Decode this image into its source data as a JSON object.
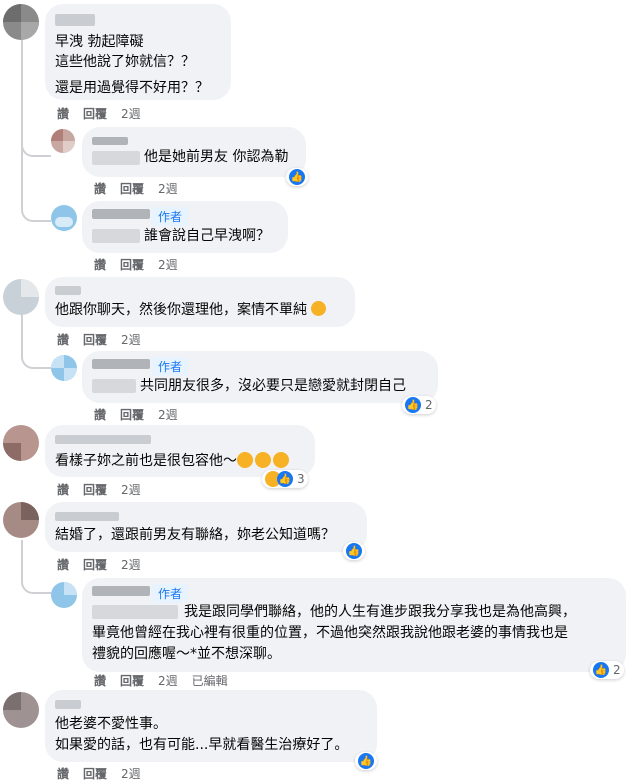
{
  "comments": [
    {
      "id": "c1",
      "lines": [
        "早洩 勃起障礙",
        "這些他說了妳就信？？",
        "還是用過覺得不好用？？"
      ],
      "actions": {
        "like": "讚",
        "reply": "回覆",
        "time": "2週"
      }
    },
    {
      "id": "c2",
      "lines": [
        "他是她前男友 你認為勒"
      ],
      "actions": {
        "like": "讚",
        "reply": "回覆",
        "time": "2週"
      }
    },
    {
      "id": "c3",
      "author_badge": "作者",
      "lines": [
        "誰會說自己早洩啊？"
      ],
      "actions": {
        "like": "讚",
        "reply": "回覆",
        "time": "2週"
      }
    },
    {
      "id": "c4",
      "lines": [
        "他跟你聊天，然後你還理他，案情不單純"
      ],
      "actions": {
        "like": "讚",
        "reply": "回覆",
        "time": "2週"
      }
    },
    {
      "id": "c5",
      "author_badge": "作者",
      "lines": [
        "共同朋友很多，沒必要只是戀愛就封閉自己"
      ],
      "reaction_count": "2",
      "actions": {
        "like": "讚",
        "reply": "回覆",
        "time": "2週"
      }
    },
    {
      "id": "c6",
      "lines": [
        "看樣子妳之前也是很包容他～"
      ],
      "reaction_count": "3",
      "actions": {
        "like": "讚",
        "reply": "回覆",
        "time": "2週"
      }
    },
    {
      "id": "c7",
      "lines": [
        "結婚了，還跟前男友有聯絡，妳老公知道嗎？"
      ],
      "actions": {
        "like": "讚",
        "reply": "回覆",
        "time": "2週"
      }
    },
    {
      "id": "c8",
      "author_badge": "作者",
      "lines": [
        "我是跟同學們聯絡，他的人生有進步跟我分享我也是為他高興，",
        "畢竟他曾經在我心裡有很重的位置，不過他突然跟我說他跟老婆的事情我也是",
        "禮貌的回應喔～*並不想深聊。"
      ],
      "reaction_count": "2",
      "actions": {
        "like": "讚",
        "reply": "回覆",
        "time": "2週",
        "edited": "已編輯"
      }
    },
    {
      "id": "c9",
      "lines": [
        "他老婆不愛性事。",
        "如果愛的話，也有可能...早就看醫生治療好了。"
      ],
      "actions": {
        "like": "讚",
        "reply": "回覆",
        "time": "2週"
      }
    }
  ],
  "colors": {
    "bubble": "#f0f2f5",
    "like_blue": "#1877f2",
    "meta_gray": "#65676b"
  }
}
